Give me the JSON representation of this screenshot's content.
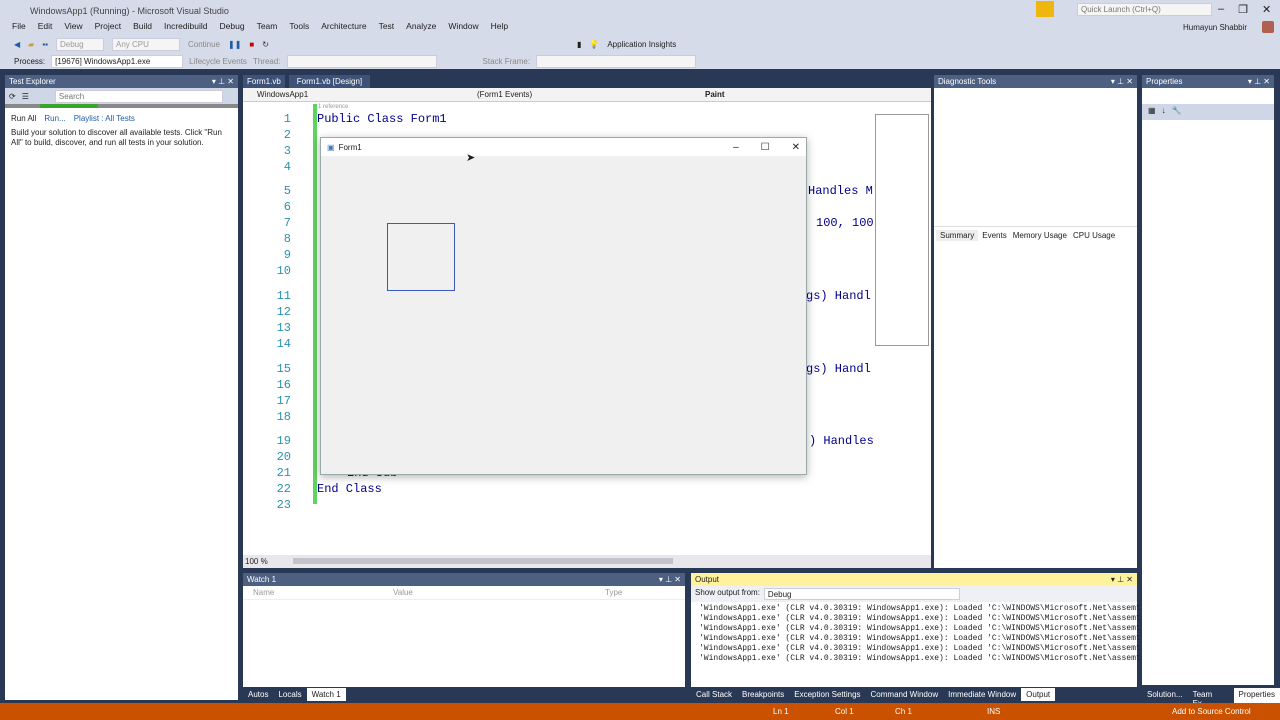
{
  "window": {
    "title": "WindowsApp1 (Running) - Microsoft Visual Studio",
    "quick_launch_placeholder": "Quick Launch (Ctrl+Q)",
    "user": "Humayun Shabbir"
  },
  "menu": [
    "File",
    "Edit",
    "View",
    "Project",
    "Build",
    "Incredibuild",
    "Debug",
    "Team",
    "Tools",
    "Architecture",
    "Test",
    "Analyze",
    "Window",
    "Help"
  ],
  "toolbar": {
    "config": "Debug",
    "platform": "Any CPU",
    "continue": "Continue",
    "app_insights": "Application Insights"
  },
  "debug_bar": {
    "process_label": "Process:",
    "process": "[19676] WindowsApp1.exe",
    "lifecycle": "Lifecycle Events",
    "thread": "Thread:",
    "stack_frame": "Stack Frame:"
  },
  "test_explorer": {
    "title": "Test Explorer",
    "search_placeholder": "Search",
    "run_all": "Run All",
    "run": "Run...",
    "playlist": "Playlist : All Tests",
    "message": "Build your solution to discover all available tests. Click \"Run All\" to build, discover, and run all tests in your solution.",
    "progress": 0.25
  },
  "editor": {
    "tabs": [
      "Form1.vb",
      "Form1.vb [Design]"
    ],
    "project": "WindowsApp1",
    "object": "(Form1 Events)",
    "member": "Paint",
    "ref_hint": "1 reference",
    "zoom": "100 %",
    "lines": [
      {
        "n": "1",
        "t": "Public Class Form1"
      },
      {
        "n": "2",
        "t": ""
      },
      {
        "n": "3",
        "t": ""
      },
      {
        "n": "4",
        "t": ""
      },
      {
        "n": "5",
        "t": "Handles M"
      },
      {
        "n": "6",
        "t": ""
      },
      {
        "n": "7",
        "t": "100, 100"
      },
      {
        "n": "8",
        "t": ""
      },
      {
        "n": "9",
        "t": ""
      },
      {
        "n": "10",
        "t": ""
      },
      {
        "n": "11",
        "t": "gs) Handl"
      },
      {
        "n": "12",
        "t": ""
      },
      {
        "n": "13",
        "t": ""
      },
      {
        "n": "14",
        "t": ""
      },
      {
        "n": "15",
        "t": "gs) Handl"
      },
      {
        "n": "16",
        "t": ""
      },
      {
        "n": "17",
        "t": ""
      },
      {
        "n": "18",
        "t": ""
      },
      {
        "n": "19",
        "t": ") Handles"
      },
      {
        "n": "20",
        "t": ""
      },
      {
        "n": "21",
        "t": "End Sub"
      },
      {
        "n": "22",
        "t": "End Class"
      },
      {
        "n": "23",
        "t": ""
      }
    ]
  },
  "form_window": {
    "title": "Form1"
  },
  "diagnostic": {
    "title": "Diagnostic Tools",
    "tabs": [
      "Summary",
      "Events",
      "Memory Usage",
      "CPU Usage"
    ]
  },
  "properties": {
    "title": "Properties"
  },
  "watch": {
    "title": "Watch 1",
    "columns": [
      "Name",
      "Value",
      "Type"
    ],
    "tabs": [
      "Autos",
      "Locals",
      "Watch 1"
    ]
  },
  "output": {
    "title": "Output",
    "show_from_label": "Show output from:",
    "source": "Debug",
    "lines": [
      "'WindowsApp1.exe' (CLR v4.0.30319: WindowsApp1.exe): Loaded 'C:\\WINDOWS\\Microsoft.Net\\assemt",
      "'WindowsApp1.exe' (CLR v4.0.30319: WindowsApp1.exe): Loaded 'C:\\WINDOWS\\Microsoft.Net\\assemt",
      "'WindowsApp1.exe' (CLR v4.0.30319: WindowsApp1.exe): Loaded 'C:\\WINDOWS\\Microsoft.Net\\assemt",
      "'WindowsApp1.exe' (CLR v4.0.30319: WindowsApp1.exe): Loaded 'C:\\WINDOWS\\Microsoft.Net\\assemt",
      "'WindowsApp1.exe' (CLR v4.0.30319: WindowsApp1.exe): Loaded 'C:\\WINDOWS\\Microsoft.Net\\assemt",
      "'WindowsApp1.exe' (CLR v4.0.30319: WindowsApp1.exe): Loaded 'C:\\WINDOWS\\Microsoft.Net\\assemt"
    ],
    "tabs": [
      "Call Stack",
      "Breakpoints",
      "Exception Settings",
      "Command Window",
      "Immediate Window",
      "Output"
    ]
  },
  "right_tabs": [
    "Solution...",
    "Team Ex...",
    "Properties"
  ],
  "status": {
    "ln": "Ln 1",
    "col": "Col 1",
    "ch": "Ch 1",
    "ins": "INS",
    "source_control": "Add to Source Control"
  },
  "colors": {
    "status_bar": "#ca5100",
    "frame": "#293955",
    "active_header": "#fff29d"
  }
}
